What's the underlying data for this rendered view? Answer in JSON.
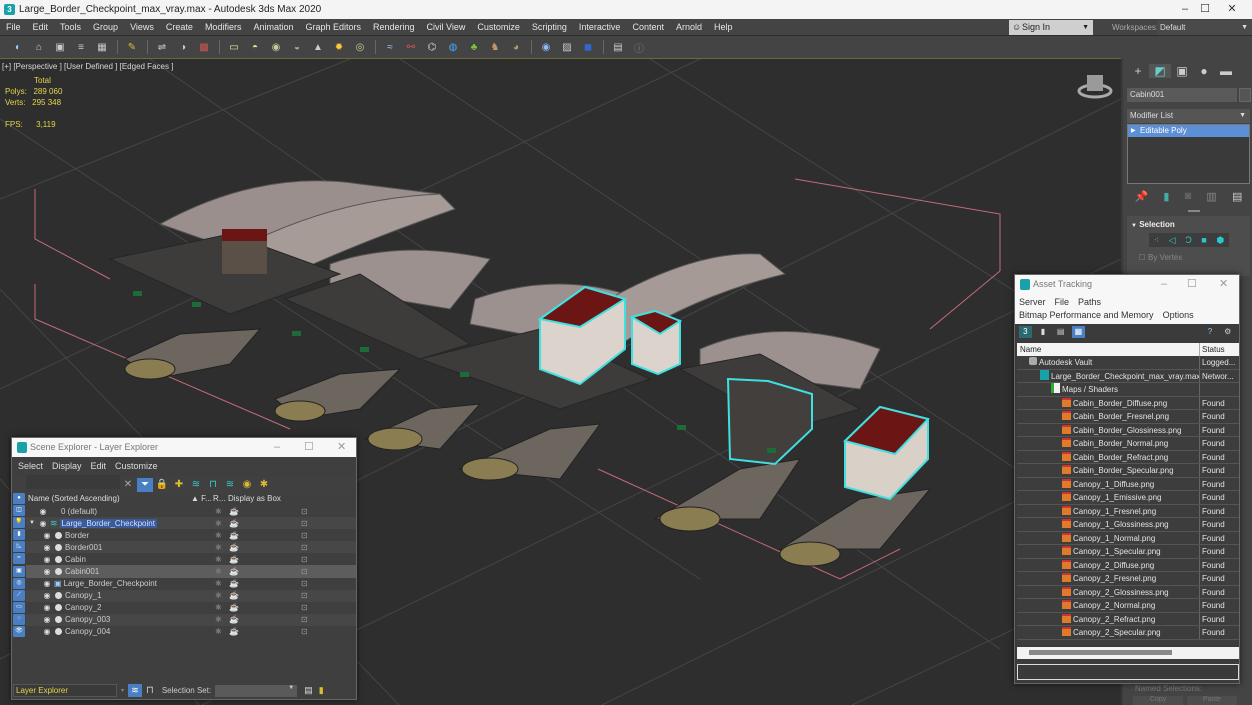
{
  "window": {
    "title": "Large_Border_Checkpoint_max_vray.max - Autodesk 3ds Max 2020",
    "minimize": "–",
    "maximize": "☐",
    "close": "✕"
  },
  "menu": [
    "File",
    "Edit",
    "Tools",
    "Group",
    "Views",
    "Create",
    "Modifiers",
    "Animation",
    "Graph Editors",
    "Rendering",
    "Civil View",
    "Customize",
    "Scripting",
    "Interactive",
    "Content",
    "Arnold",
    "Help"
  ],
  "account": {
    "sign_in": "Sign In",
    "workspaces_label": "Workspaces:",
    "workspace": "Default"
  },
  "toolbar_icons": [
    "undo-scene-icon",
    "hold-icon",
    "render-frame-icon",
    "list-icon",
    "table-icon",
    "light-icon",
    "link-icon",
    "bind-icon",
    "camera-icon",
    "plane-icon",
    "sphere-icon",
    "geosphere-icon",
    "torus-icon",
    "cone-icon",
    "sun-icon",
    "sphere2-icon",
    "wave-icon",
    "dumbbell-icon",
    "hierarchy-icon",
    "globe-icon",
    "leaf-icon",
    "horse-icon",
    "texture-icon",
    "render-setup-icon",
    "render-teapot-icon",
    "render-icon",
    "layer-icon",
    "help-icon"
  ],
  "viewport": {
    "label": "[+] [Perspective ] [User Defined ] [Edged Faces ]",
    "stats_header": "Total",
    "polys_label": "Polys:",
    "polys": "289 060",
    "verts_label": "Verts:",
    "verts": "295 348",
    "fps_label": "FPS:",
    "fps": "3,119",
    "selection_color": "#3fe0e0"
  },
  "command_panel": {
    "object_name": "Cabin001",
    "modifier_list": "Modifier List",
    "stack": [
      "Editable Poly"
    ],
    "selection_title": "Selection",
    "by_vertex": "By Vertex",
    "named_selections": "Named Selections:",
    "copy": "Copy",
    "paste": "Paste"
  },
  "asset_tracking": {
    "title": "Asset Tracking",
    "menu": [
      "Server",
      "File",
      "Paths",
      "Bitmap Performance and Memory",
      "Options"
    ],
    "columns": [
      "Name",
      "Status"
    ],
    "rows": [
      {
        "name": "Autodesk Vault",
        "status": "Logged...",
        "level": 0,
        "icon": "vault-icon"
      },
      {
        "name": "Large_Border_Checkpoint_max_vray.max",
        "status": "Networ...",
        "level": 1,
        "icon": "max-file-icon"
      },
      {
        "name": "Maps / Shaders",
        "status": "",
        "level": 2,
        "icon": "maps-folder-icon"
      },
      {
        "name": "Cabin_Border_Diffuse.png",
        "status": "Found",
        "level": 3,
        "icon": "bitmap-icon"
      },
      {
        "name": "Cabin_Border_Fresnel.png",
        "status": "Found",
        "level": 3,
        "icon": "bitmap-icon"
      },
      {
        "name": "Cabin_Border_Glossiness.png",
        "status": "Found",
        "level": 3,
        "icon": "bitmap-icon"
      },
      {
        "name": "Cabin_Border_Normal.png",
        "status": "Found",
        "level": 3,
        "icon": "bitmap-icon"
      },
      {
        "name": "Cabin_Border_Refract.png",
        "status": "Found",
        "level": 3,
        "icon": "bitmap-icon"
      },
      {
        "name": "Cabin_Border_Specular.png",
        "status": "Found",
        "level": 3,
        "icon": "bitmap-icon"
      },
      {
        "name": "Canopy_1_Diffuse.png",
        "status": "Found",
        "level": 3,
        "icon": "bitmap-icon"
      },
      {
        "name": "Canopy_1_Emissive.png",
        "status": "Found",
        "level": 3,
        "icon": "bitmap-icon"
      },
      {
        "name": "Canopy_1_Fresnel.png",
        "status": "Found",
        "level": 3,
        "icon": "bitmap-icon"
      },
      {
        "name": "Canopy_1_Glossiness.png",
        "status": "Found",
        "level": 3,
        "icon": "bitmap-icon"
      },
      {
        "name": "Canopy_1_Normal.png",
        "status": "Found",
        "level": 3,
        "icon": "bitmap-icon"
      },
      {
        "name": "Canopy_1_Specular.png",
        "status": "Found",
        "level": 3,
        "icon": "bitmap-icon"
      },
      {
        "name": "Canopy_2_Diffuse.png",
        "status": "Found",
        "level": 3,
        "icon": "bitmap-icon"
      },
      {
        "name": "Canopy_2_Fresnel.png",
        "status": "Found",
        "level": 3,
        "icon": "bitmap-icon"
      },
      {
        "name": "Canopy_2_Glossiness.png",
        "status": "Found",
        "level": 3,
        "icon": "bitmap-icon"
      },
      {
        "name": "Canopy_2_Normal.png",
        "status": "Found",
        "level": 3,
        "icon": "bitmap-icon"
      },
      {
        "name": "Canopy_2_Refract.png",
        "status": "Found",
        "level": 3,
        "icon": "bitmap-icon"
      },
      {
        "name": "Canopy_2_Specular.png",
        "status": "Found",
        "level": 3,
        "icon": "bitmap-icon"
      }
    ],
    "path_value": ""
  },
  "scene_explorer": {
    "title": "Scene Explorer - Layer Explorer",
    "menu": [
      "Select",
      "Display",
      "Edit",
      "Customize"
    ],
    "search_value": "",
    "columns": [
      "Name (Sorted Ascending)",
      "▲ F...",
      "R...",
      "Display as Box"
    ],
    "rows": [
      {
        "name": "0 (default)",
        "level": 0,
        "type": "layer",
        "expanded": false,
        "selected": false
      },
      {
        "name": "Large_Border_Checkpoint",
        "level": 0,
        "type": "layer-active",
        "expanded": true,
        "selected": false
      },
      {
        "name": "Border",
        "level": 1,
        "type": "object",
        "selected": false
      },
      {
        "name": "Border001",
        "level": 1,
        "type": "object",
        "selected": false
      },
      {
        "name": "Cabin",
        "level": 1,
        "type": "object",
        "selected": false
      },
      {
        "name": "Cabin001",
        "level": 1,
        "type": "object",
        "selected": true
      },
      {
        "name": "Large_Border_Checkpoint",
        "level": 1,
        "type": "group",
        "selected": false
      },
      {
        "name": "Canopy_1",
        "level": 1,
        "type": "object",
        "selected": false
      },
      {
        "name": "Canopy_2",
        "level": 1,
        "type": "object",
        "selected": false
      },
      {
        "name": "Canopy_003",
        "level": 1,
        "type": "object",
        "selected": false
      },
      {
        "name": "Canopy_004",
        "level": 1,
        "type": "object",
        "selected": false
      }
    ],
    "explorer_mode": "Layer Explorer",
    "selection_set_label": "Selection Set:",
    "selection_set_value": ""
  }
}
